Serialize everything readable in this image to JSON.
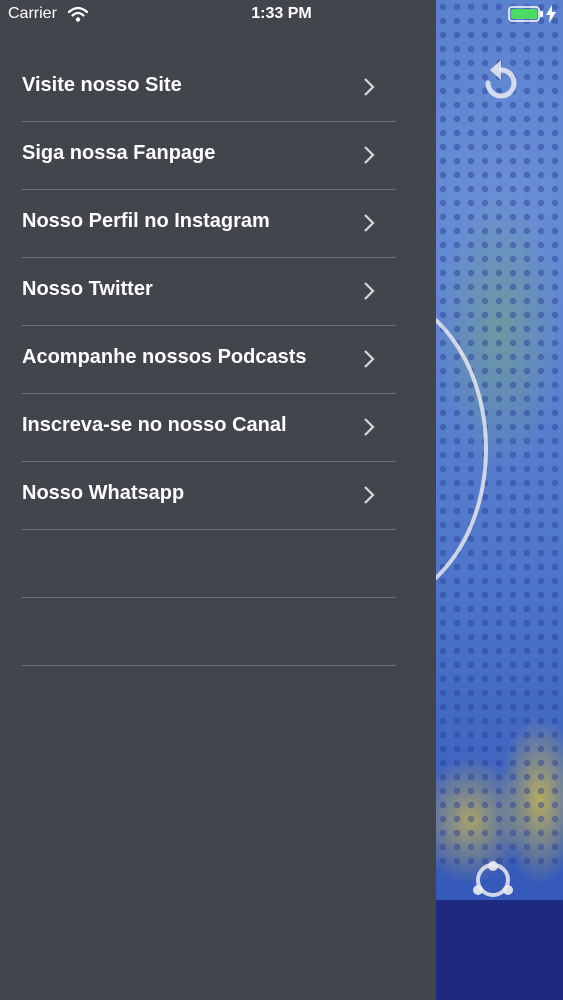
{
  "status_bar": {
    "carrier": "Carrier",
    "time": "1:33 PM",
    "battery_color": "#4cd964"
  },
  "menu": {
    "background": "#43454c",
    "items": [
      {
        "label": "Visite nosso Site"
      },
      {
        "label": "Siga nossa Fanpage"
      },
      {
        "label": "Nosso Perfil no Instagram"
      },
      {
        "label": "Nosso Twitter"
      },
      {
        "label": "Acompanhe nossos Podcasts"
      },
      {
        "label": "Inscreva-se no nosso Canal"
      },
      {
        "label": "Nosso Whatsapp"
      },
      {
        "label": ""
      },
      {
        "label": ""
      }
    ]
  },
  "background_app": {
    "icons": [
      "refresh-icon",
      "share-icon"
    ]
  }
}
